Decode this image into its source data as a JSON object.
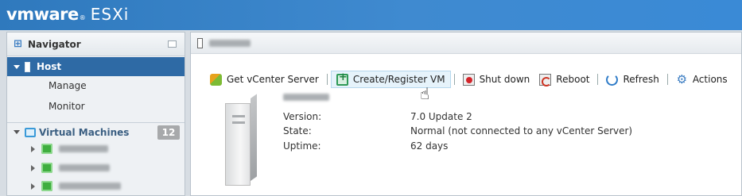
{
  "brand": {
    "vm": "vmware",
    "reg": "®",
    "product": "ESXi"
  },
  "navigator": {
    "title": "Navigator",
    "host": {
      "label": "Host",
      "items": [
        "Manage",
        "Monitor"
      ]
    },
    "virtual_machines": {
      "label": "Virtual Machines",
      "count": "12"
    }
  },
  "toolbar": {
    "get_vcenter": "Get vCenter Server",
    "create_register": "Create/Register VM",
    "shut_down": "Shut down",
    "reboot": "Reboot",
    "refresh": "Refresh",
    "actions": "Actions"
  },
  "host_info": {
    "version_label": "Version:",
    "version_value": "7.0 Update 2",
    "state_label": "State:",
    "state_value": "Normal (not connected to any vCenter Server)",
    "uptime_label": "Uptime:",
    "uptime_value": "62 days"
  },
  "icons": {
    "navigator": "navigator-icon",
    "host": "host-icon",
    "virtual_machines": "vm-folder-icon",
    "vm": "vm-powered-on-icon"
  },
  "colors": {
    "topbar": "#3a87cf",
    "selected_row": "#2e6aa5",
    "badge": "#a7a9ab"
  }
}
